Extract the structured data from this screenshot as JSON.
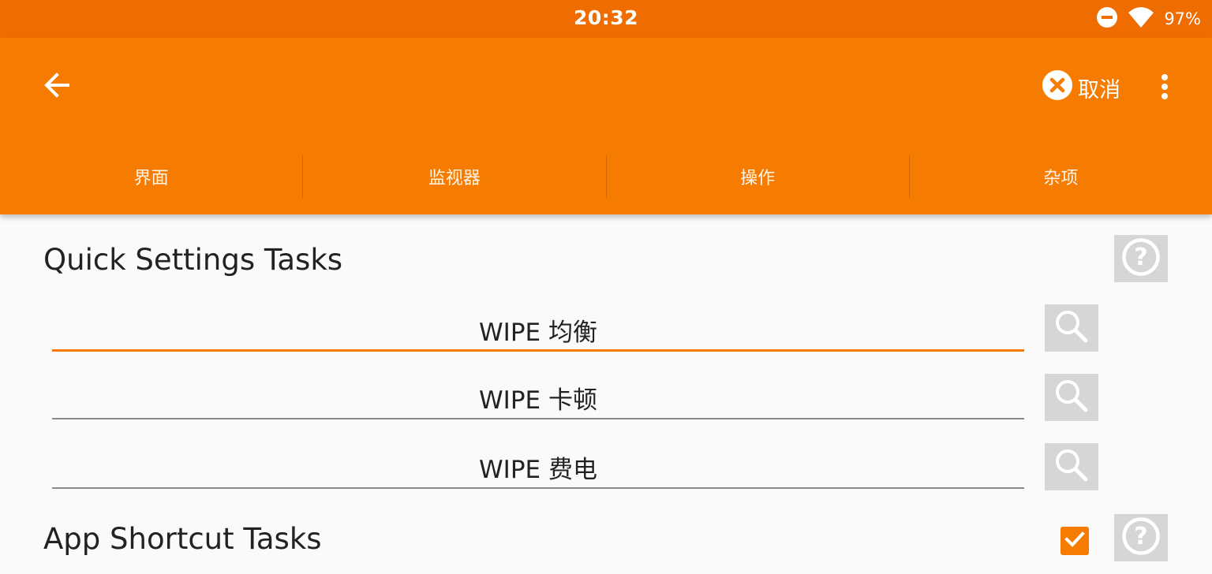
{
  "status_bar": {
    "time": "20:32",
    "battery": "97%",
    "icons": [
      "do-not-disturb-icon",
      "wifi-icon"
    ]
  },
  "app_bar": {
    "back_icon": "arrow-back-icon",
    "cancel_label": "取消",
    "cancel_icon": "close-circle-icon",
    "overflow_icon": "more-vert-icon"
  },
  "tabs": [
    {
      "label": "界面"
    },
    {
      "label": "监视器"
    },
    {
      "label": "操作"
    },
    {
      "label": "杂项"
    }
  ],
  "quick_settings": {
    "title": "Quick Settings Tasks",
    "tasks": [
      {
        "value": "WIPE 均衡",
        "focused": true
      },
      {
        "value": "WIPE 卡顿",
        "focused": false
      },
      {
        "value": "WIPE 费电",
        "focused": false
      }
    ]
  },
  "app_shortcut": {
    "title": "App Shortcut Tasks",
    "checked": true
  },
  "colors": {
    "status_bar": "#ef6c00",
    "app_bar": "#f57c00",
    "accent": "#f57c00",
    "button_bg": "#d6d6d6"
  }
}
